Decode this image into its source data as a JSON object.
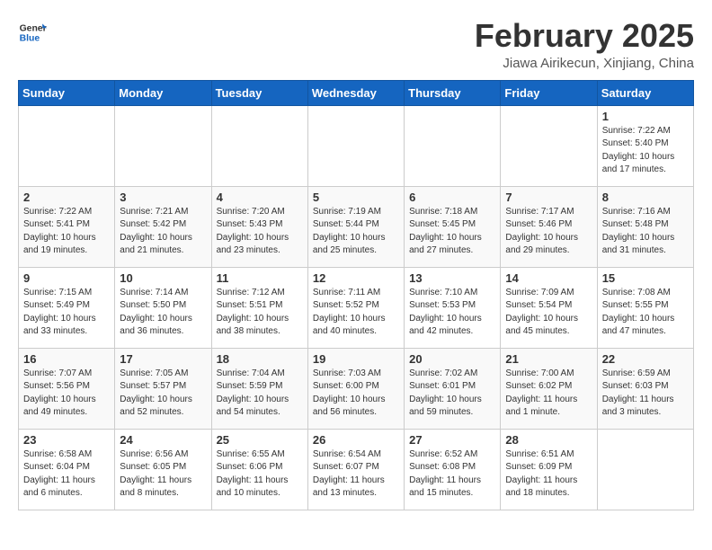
{
  "header": {
    "logo_general": "General",
    "logo_blue": "Blue",
    "title": "February 2025",
    "subtitle": "Jiawa Airikecun, Xinjiang, China"
  },
  "weekdays": [
    "Sunday",
    "Monday",
    "Tuesday",
    "Wednesday",
    "Thursday",
    "Friday",
    "Saturday"
  ],
  "weeks": [
    [
      {
        "day": "",
        "info": ""
      },
      {
        "day": "",
        "info": ""
      },
      {
        "day": "",
        "info": ""
      },
      {
        "day": "",
        "info": ""
      },
      {
        "day": "",
        "info": ""
      },
      {
        "day": "",
        "info": ""
      },
      {
        "day": "1",
        "info": "Sunrise: 7:22 AM\nSunset: 5:40 PM\nDaylight: 10 hours\nand 17 minutes."
      }
    ],
    [
      {
        "day": "2",
        "info": "Sunrise: 7:22 AM\nSunset: 5:41 PM\nDaylight: 10 hours\nand 19 minutes."
      },
      {
        "day": "3",
        "info": "Sunrise: 7:21 AM\nSunset: 5:42 PM\nDaylight: 10 hours\nand 21 minutes."
      },
      {
        "day": "4",
        "info": "Sunrise: 7:20 AM\nSunset: 5:43 PM\nDaylight: 10 hours\nand 23 minutes."
      },
      {
        "day": "5",
        "info": "Sunrise: 7:19 AM\nSunset: 5:44 PM\nDaylight: 10 hours\nand 25 minutes."
      },
      {
        "day": "6",
        "info": "Sunrise: 7:18 AM\nSunset: 5:45 PM\nDaylight: 10 hours\nand 27 minutes."
      },
      {
        "day": "7",
        "info": "Sunrise: 7:17 AM\nSunset: 5:46 PM\nDaylight: 10 hours\nand 29 minutes."
      },
      {
        "day": "8",
        "info": "Sunrise: 7:16 AM\nSunset: 5:48 PM\nDaylight: 10 hours\nand 31 minutes."
      }
    ],
    [
      {
        "day": "9",
        "info": "Sunrise: 7:15 AM\nSunset: 5:49 PM\nDaylight: 10 hours\nand 33 minutes."
      },
      {
        "day": "10",
        "info": "Sunrise: 7:14 AM\nSunset: 5:50 PM\nDaylight: 10 hours\nand 36 minutes."
      },
      {
        "day": "11",
        "info": "Sunrise: 7:12 AM\nSunset: 5:51 PM\nDaylight: 10 hours\nand 38 minutes."
      },
      {
        "day": "12",
        "info": "Sunrise: 7:11 AM\nSunset: 5:52 PM\nDaylight: 10 hours\nand 40 minutes."
      },
      {
        "day": "13",
        "info": "Sunrise: 7:10 AM\nSunset: 5:53 PM\nDaylight: 10 hours\nand 42 minutes."
      },
      {
        "day": "14",
        "info": "Sunrise: 7:09 AM\nSunset: 5:54 PM\nDaylight: 10 hours\nand 45 minutes."
      },
      {
        "day": "15",
        "info": "Sunrise: 7:08 AM\nSunset: 5:55 PM\nDaylight: 10 hours\nand 47 minutes."
      }
    ],
    [
      {
        "day": "16",
        "info": "Sunrise: 7:07 AM\nSunset: 5:56 PM\nDaylight: 10 hours\nand 49 minutes."
      },
      {
        "day": "17",
        "info": "Sunrise: 7:05 AM\nSunset: 5:57 PM\nDaylight: 10 hours\nand 52 minutes."
      },
      {
        "day": "18",
        "info": "Sunrise: 7:04 AM\nSunset: 5:59 PM\nDaylight: 10 hours\nand 54 minutes."
      },
      {
        "day": "19",
        "info": "Sunrise: 7:03 AM\nSunset: 6:00 PM\nDaylight: 10 hours\nand 56 minutes."
      },
      {
        "day": "20",
        "info": "Sunrise: 7:02 AM\nSunset: 6:01 PM\nDaylight: 10 hours\nand 59 minutes."
      },
      {
        "day": "21",
        "info": "Sunrise: 7:00 AM\nSunset: 6:02 PM\nDaylight: 11 hours\nand 1 minute."
      },
      {
        "day": "22",
        "info": "Sunrise: 6:59 AM\nSunset: 6:03 PM\nDaylight: 11 hours\nand 3 minutes."
      }
    ],
    [
      {
        "day": "23",
        "info": "Sunrise: 6:58 AM\nSunset: 6:04 PM\nDaylight: 11 hours\nand 6 minutes."
      },
      {
        "day": "24",
        "info": "Sunrise: 6:56 AM\nSunset: 6:05 PM\nDaylight: 11 hours\nand 8 minutes."
      },
      {
        "day": "25",
        "info": "Sunrise: 6:55 AM\nSunset: 6:06 PM\nDaylight: 11 hours\nand 10 minutes."
      },
      {
        "day": "26",
        "info": "Sunrise: 6:54 AM\nSunset: 6:07 PM\nDaylight: 11 hours\nand 13 minutes."
      },
      {
        "day": "27",
        "info": "Sunrise: 6:52 AM\nSunset: 6:08 PM\nDaylight: 11 hours\nand 15 minutes."
      },
      {
        "day": "28",
        "info": "Sunrise: 6:51 AM\nSunset: 6:09 PM\nDaylight: 11 hours\nand 18 minutes."
      },
      {
        "day": "",
        "info": ""
      }
    ]
  ]
}
